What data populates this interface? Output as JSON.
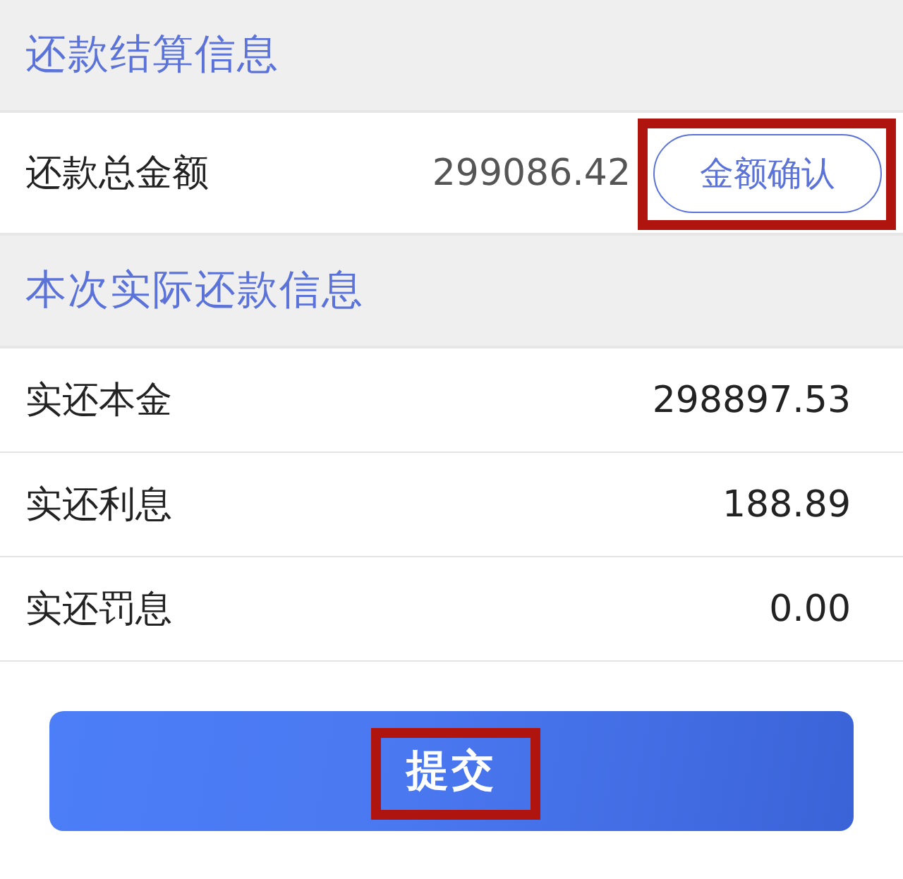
{
  "sections": [
    {
      "title": "还款结算信息",
      "rows": [
        {
          "kind": "confirm",
          "label": "还款总金额",
          "value": "299086.42",
          "button": {
            "label": "金额确认",
            "highlighted": true
          }
        }
      ]
    },
    {
      "title": "本次实际还款信息",
      "rows": [
        {
          "kind": "plain",
          "label": "实还本金",
          "value": "298897.53"
        },
        {
          "kind": "plain",
          "label": "实还利息",
          "value": "188.89"
        },
        {
          "kind": "plain",
          "label": "实还罚息",
          "value": "0.00"
        }
      ]
    }
  ],
  "submit_button": {
    "label": "提交",
    "highlighted": true
  }
}
